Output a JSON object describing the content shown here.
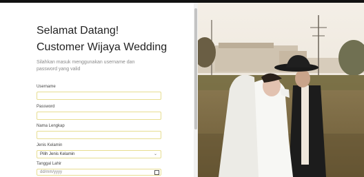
{
  "header": {
    "title_line1": "Selamat Datang!",
    "title_line2": "Customer Wijaya Wedding",
    "subtitle": "Silahkan masuk menggunakan username dan password yang valid"
  },
  "form": {
    "username_label": "Username",
    "password_label": "Password",
    "fullname_label": "Nama Lengkap",
    "gender_label": "Jenis Kelamin",
    "gender_selected": "Pilih Jenis Kelamin",
    "birthdate_label": "Tanggal Lahir",
    "birthdate_placeholder": "dd/mm/yyyy"
  },
  "icons": {
    "select_arrow": "chevron-down-icon",
    "date_picker": "calendar-icon"
  },
  "colors": {
    "field_border": "#e7dd90",
    "title_text": "#222222",
    "subtitle_text": "#8a8a8a"
  }
}
